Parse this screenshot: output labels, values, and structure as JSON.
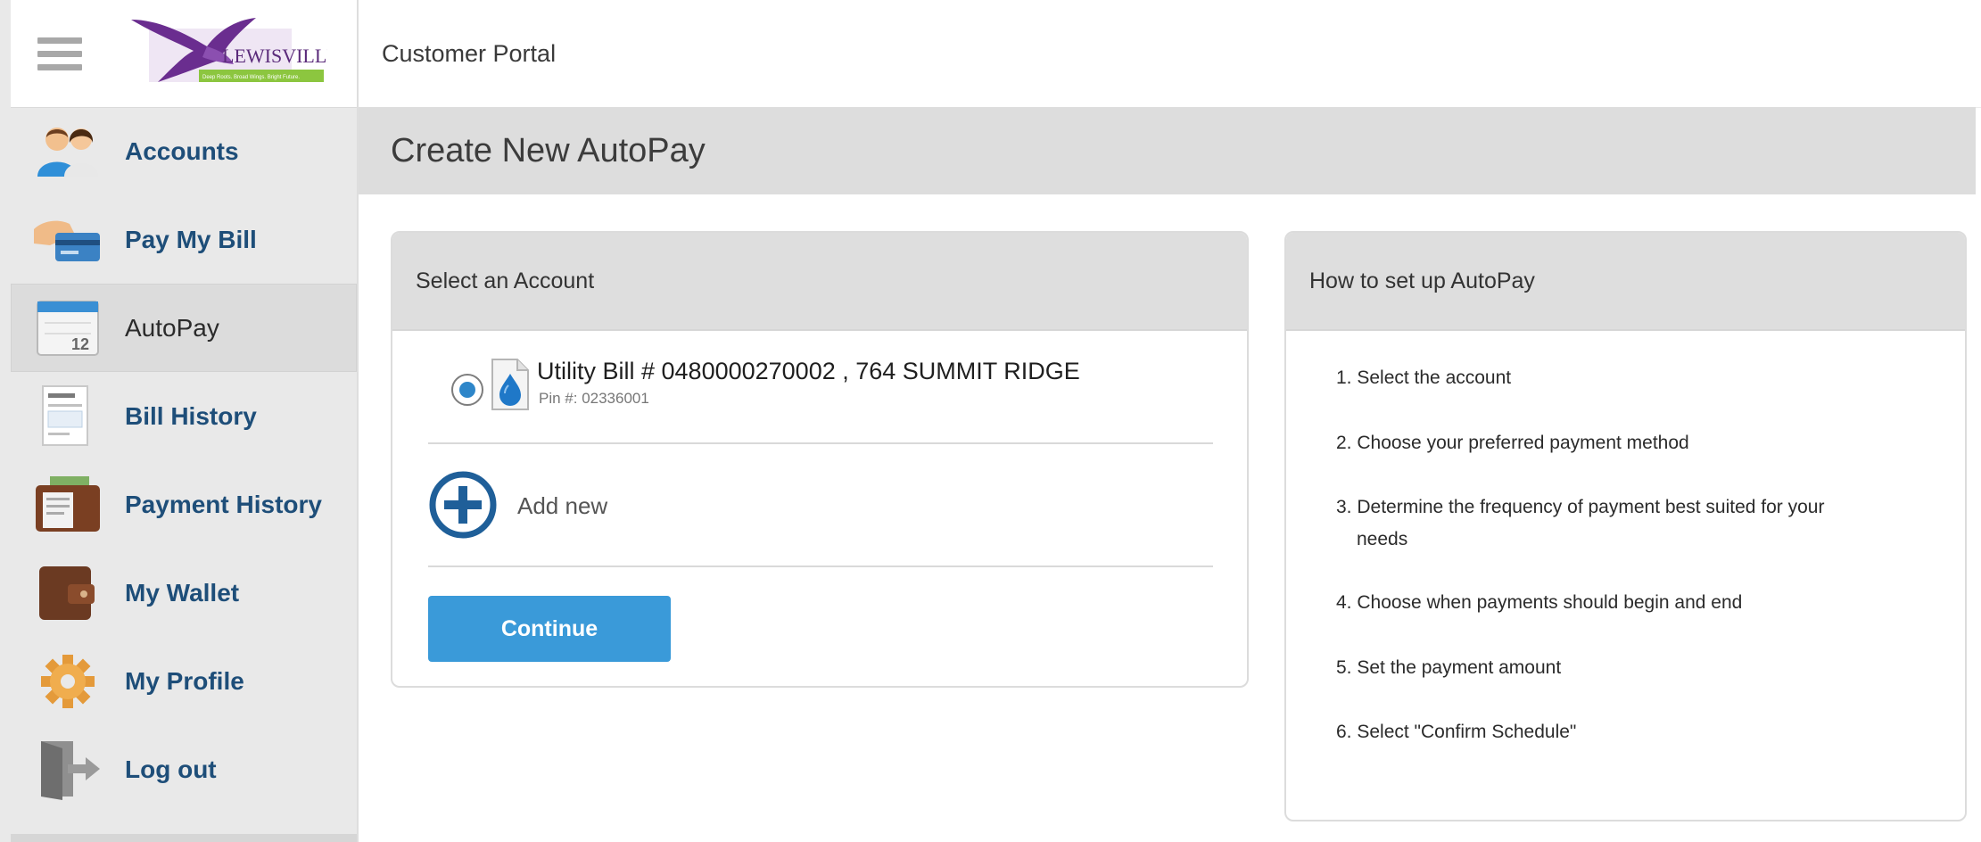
{
  "app": {
    "portal_title": "Customer Portal",
    "logo_text": "LEWISVILLE",
    "logo_tagline": "Deep Roots. Broad Wings. Bright Future."
  },
  "sidebar": {
    "items": [
      {
        "label": "Accounts",
        "icon": "accounts-icon",
        "active": false
      },
      {
        "label": "Pay My Bill",
        "icon": "credit-card-icon",
        "active": false
      },
      {
        "label": "AutoPay",
        "icon": "calendar-icon",
        "calendar_day": "12",
        "active": true
      },
      {
        "label": "Bill History",
        "icon": "invoice-icon",
        "active": false
      },
      {
        "label": "Payment History",
        "icon": "wallet-cash-icon",
        "active": false
      },
      {
        "label": "My Wallet",
        "icon": "wallet-icon",
        "active": false
      },
      {
        "label": "My Profile",
        "icon": "gear-icon",
        "active": false
      },
      {
        "label": "Log out",
        "icon": "logout-door-icon",
        "active": false
      }
    ]
  },
  "page": {
    "title": "Create New AutoPay"
  },
  "select_account": {
    "header": "Select an Account",
    "account": {
      "title": "Utility Bill # 0480000270002 , 764 SUMMIT RIDGE",
      "pin": "Pin #: 02336001",
      "selected": true
    },
    "add_new_label": "Add new",
    "continue_label": "Continue"
  },
  "howto": {
    "header": "How to set up AutoPay",
    "steps": [
      "1. Select the account",
      "2. Choose your preferred payment method",
      "3. Determine the frequency of payment best suited for your",
      "needs",
      "4. Choose when payments should begin and end",
      "5. Set the payment amount",
      "6. Select \"Confirm Schedule\""
    ]
  },
  "colors": {
    "accent": "#3a9ad9",
    "nav_text": "#1e4e79",
    "header_bg": "#dddddd",
    "brand_purple": "#6a2d8f"
  }
}
